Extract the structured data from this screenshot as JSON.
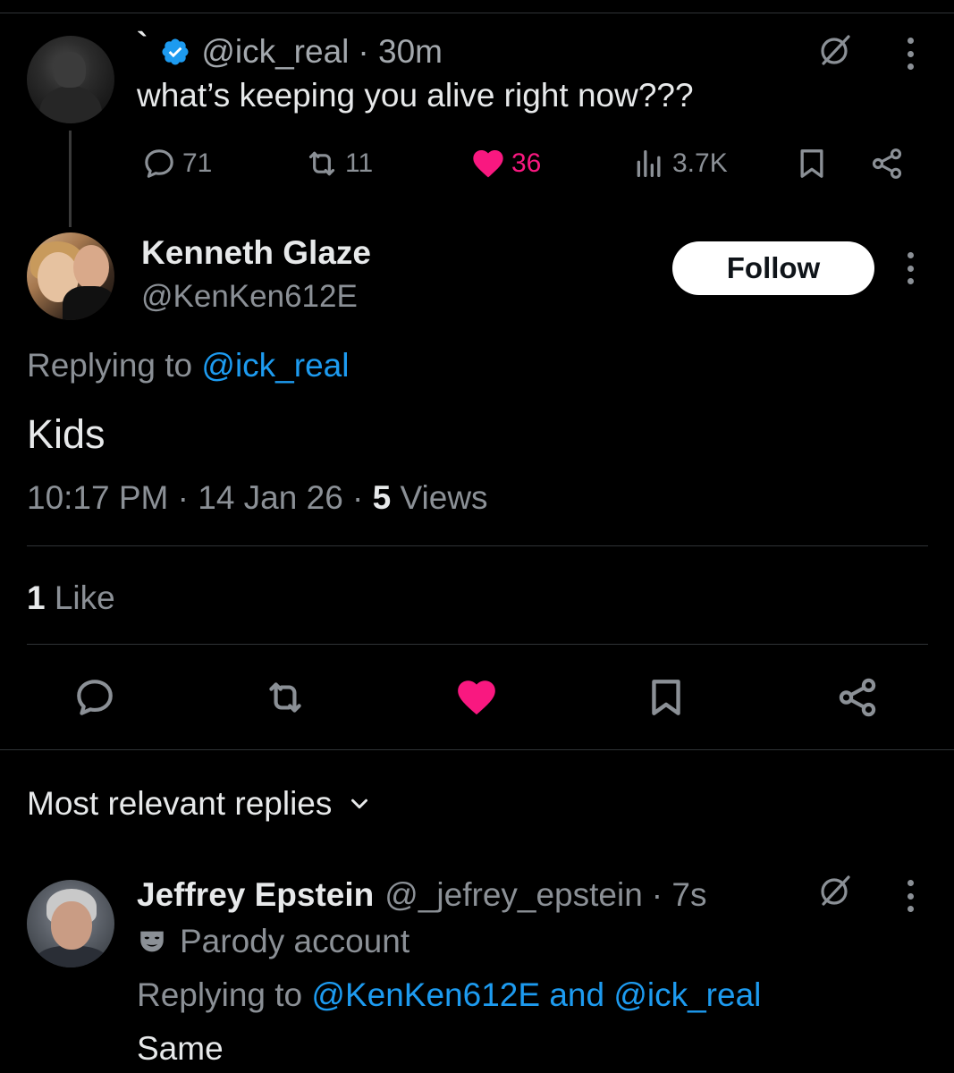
{
  "parent_tweet": {
    "display_name": "`",
    "handle": "@ick_real",
    "time": "· 30m",
    "text": "what’s keeping you alive right now???",
    "replies": "71",
    "reposts": "11",
    "likes": "36",
    "views": "3.7K",
    "liked": true
  },
  "focused_reply": {
    "name": "Kenneth Glaze",
    "handle": "@KenKen612E",
    "follow_label": "Follow",
    "replying_prefix": "Replying to",
    "replying_to": "@ick_real",
    "text": "Kids",
    "timestamp": "10:17 PM · 14 Jan 26 ·",
    "views_count": "5",
    "views_label": "Views",
    "likes_count": "1",
    "likes_label": "Like",
    "liked": true
  },
  "replies_section": {
    "sort_label": "Most relevant replies"
  },
  "bottom_reply": {
    "name": "Jeffrey Epstein",
    "handle": "@_jefrey_epstein",
    "time": "· 7s",
    "badge_label": "Parody account",
    "replying_prefix": "Replying to",
    "replying_to_1": "@KenKen612E",
    "replying_and": "and",
    "replying_to_2": "@ick_real",
    "text": "Same"
  },
  "colors": {
    "background": "#000000",
    "text_primary": "#e7e9ea",
    "text_secondary": "#8b9096",
    "link": "#1d9bf0",
    "like": "#f91880",
    "verified": "#1d9bf0",
    "divider": "#2f3336"
  },
  "icons": [
    "verified-badge-icon",
    "grok-icon",
    "more-icon",
    "reply-icon",
    "repost-icon",
    "heart-icon",
    "views-icon",
    "bookmark-icon",
    "share-icon",
    "chevron-down-icon",
    "parody-mask-icon"
  ]
}
